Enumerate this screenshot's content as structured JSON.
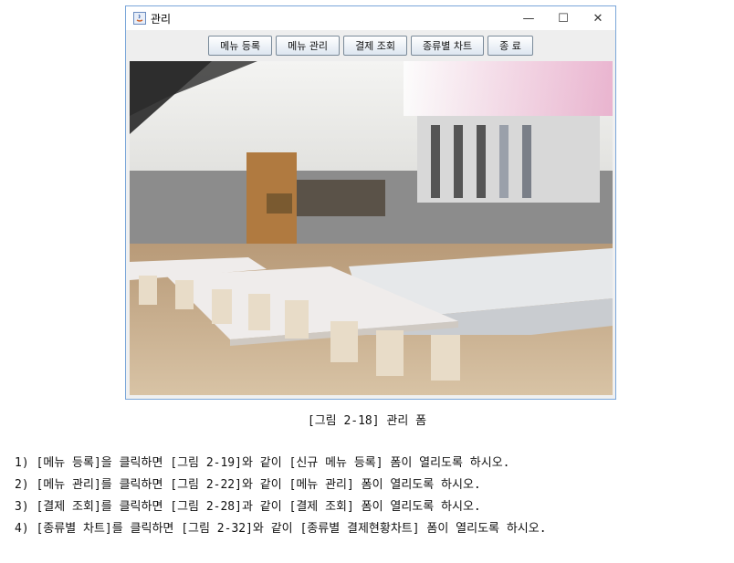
{
  "window": {
    "title": "관리",
    "controls": {
      "minimize": "—",
      "maximize": "☐",
      "close": "✕"
    }
  },
  "toolbar": {
    "buttons": [
      "메뉴 등록",
      "메뉴 관리",
      "결제 조회",
      "종류별 차트",
      "종 료"
    ]
  },
  "main_image": {
    "subject": "cafeteria-photo"
  },
  "caption": "[그림 2-18] 관리 폼",
  "instructions": [
    "1) [메뉴 등록]을 클릭하면 [그림 2-19]와 같이 [신규 메뉴 등록] 폼이 열리도록 하시오.",
    "2) [메뉴 관리]를 클릭하면 [그림 2-22]와 같이 [메뉴 관리] 폼이 열리도록 하시오.",
    "3) [결제 조회]를 클릭하면 [그림 2-28]과 같이 [결제 조회] 폼이 열리도록 하시오.",
    "4) [종류별 차트]를 클릭하면 [그림 2-32]와 같이 [종류별 결제현황차트] 폼이 열리도록 하시오."
  ]
}
